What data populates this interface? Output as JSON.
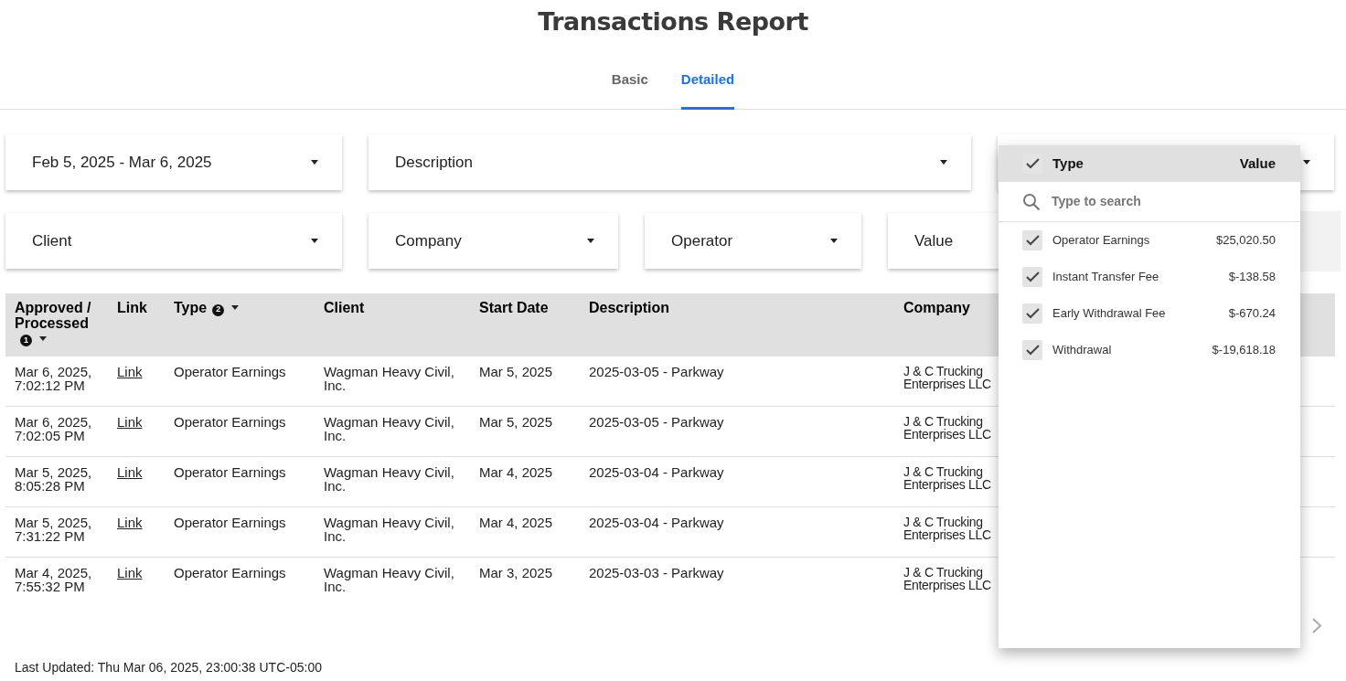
{
  "title": "Transactions Report",
  "tabs": [
    {
      "label": "Basic",
      "selected": false
    },
    {
      "label": "Detailed",
      "selected": true
    }
  ],
  "filter_rows": [
    [
      {
        "kind": "select",
        "label": "Feb 5, 2025 - Mar 6, 2025"
      },
      {
        "kind": "select",
        "label": "Description"
      },
      {
        "kind": "select"
      }
    ],
    [
      {
        "kind": "select",
        "label": "Client"
      },
      {
        "kind": "select",
        "label": "Company"
      },
      {
        "kind": "select",
        "label": "Operator"
      },
      {
        "kind": "select",
        "label": "Value"
      },
      {
        "kind": "panel"
      }
    ]
  ],
  "table": {
    "columns": [
      {
        "label": "Approved / Processed",
        "sort_badge": "1",
        "sortable": true
      },
      {
        "label": "Link",
        "kind": "link"
      },
      {
        "label": "Type",
        "sort_badge": "2",
        "sortable": true
      },
      {
        "label": "Client"
      },
      {
        "label": "Start Date"
      },
      {
        "label": "Description"
      },
      {
        "label": "Company"
      }
    ],
    "rows": [
      [
        "Mar 6, 2025, 7:02:12 PM",
        "Link",
        "Operator Earnings",
        "Wagman Heavy Civil, Inc.",
        "Mar 5, 2025",
        "2025-03-05 - Parkway",
        "J & C Trucking Enterprises LLC"
      ],
      [
        "Mar 6, 2025, 7:02:05 PM",
        "Link",
        "Operator Earnings",
        "Wagman Heavy Civil, Inc.",
        "Mar 5, 2025",
        "2025-03-05 - Parkway",
        "J & C Trucking Enterprises LLC"
      ],
      [
        "Mar 5, 2025, 8:05:28 PM",
        "Link",
        "Operator Earnings",
        "Wagman Heavy Civil, Inc.",
        "Mar 4, 2025",
        "2025-03-04 - Parkway",
        "J & C Trucking Enterprises LLC"
      ],
      [
        "Mar 5, 2025, 7:31:22 PM",
        "Link",
        "Operator Earnings",
        "Wagman Heavy Civil, Inc.",
        "Mar 4, 2025",
        "2025-03-04 - Parkway",
        "J & C Trucking Enterprises LLC"
      ],
      [
        "Mar 4, 2025, 7:55:32 PM",
        "Link",
        "Operator Earnings",
        "Wagman Heavy Civil, Inc.",
        "Mar 3, 2025",
        "2025-03-03 - Parkway",
        "J & C Trucking Enterprises LLC"
      ]
    ]
  },
  "dropdown": {
    "header": {
      "checked": true,
      "label": "Type",
      "value_label": "Value"
    },
    "search": {
      "placeholder": "Type to search"
    },
    "items": [
      {
        "label": "Operator Earnings",
        "value": "$25,020.50",
        "checked": true
      },
      {
        "label": "Instant Transfer Fee",
        "value": "$-138.58",
        "checked": true
      },
      {
        "label": "Early Withdrawal Fee",
        "value": "$-670.24",
        "checked": true
      },
      {
        "label": "Withdrawal",
        "value": "$-19,618.18",
        "checked": true
      }
    ]
  },
  "last_updated": "Last Updated: Thu Mar 06, 2025, 23:00:38 UTC-05:00"
}
